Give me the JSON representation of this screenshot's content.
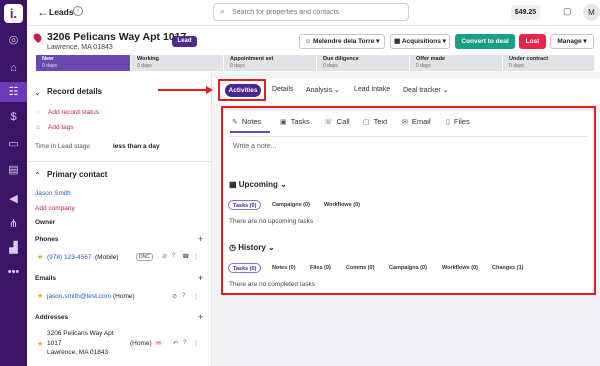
{
  "app": {
    "logo": "i."
  },
  "rail": [
    {
      "icon": "globe-icon",
      "glyph": "◎"
    },
    {
      "icon": "home-icon",
      "glyph": "⌂"
    },
    {
      "icon": "people-icon",
      "glyph": "☷"
    },
    {
      "icon": "dollar-icon",
      "glyph": "$"
    },
    {
      "icon": "inbox-icon",
      "glyph": "▭"
    },
    {
      "icon": "document-icon",
      "glyph": "▤"
    },
    {
      "icon": "megaphone-icon",
      "glyph": "◀"
    },
    {
      "icon": "tree-icon",
      "glyph": "⋔"
    },
    {
      "icon": "chart-icon",
      "glyph": "▟"
    },
    {
      "icon": "more-icon",
      "glyph": "•••"
    }
  ],
  "topbar": {
    "back_glyph": "←",
    "breadcrumb": "Leads",
    "info_glyph": "i",
    "search_placeholder": "Search for properties and contacts",
    "search_glyph": "⌕",
    "credit": "$49.25",
    "chat_glyph": "▢",
    "avatar": "M"
  },
  "header": {
    "address_line1": "3206 Pelicans Way Apt 1017",
    "address_line2": "Lawrence, MA 01843",
    "status_badge": "Lead",
    "assignee": "Melendre dela Torre",
    "acquisitions": "Acquisitions",
    "convert": "Convert to deal",
    "lost": "Lost",
    "manage": "Manage"
  },
  "stages": [
    {
      "name": "New",
      "days": "0 days",
      "active": true
    },
    {
      "name": "Working",
      "days": "0 days",
      "active": false
    },
    {
      "name": "Appointment set",
      "days": "0 days",
      "active": false
    },
    {
      "name": "Due diligence",
      "days": "0 days",
      "active": false
    },
    {
      "name": "Offer made",
      "days": "0 days",
      "active": false
    },
    {
      "name": "Under contract",
      "days": "0 days",
      "active": false
    }
  ],
  "record": {
    "title": "Record details",
    "add_status": "Add record status",
    "add_tags": "Add tags",
    "time_label": "Time in Lead stage",
    "time_value": "less than a day"
  },
  "contact": {
    "title": "Primary contact",
    "name": "Jason Smith",
    "add_company": "Add company",
    "owner_label": "Owner",
    "phones_label": "Phones",
    "phone": "(978) 123-4567",
    "phone_type": "(Mobile)",
    "dnc": "DNC",
    "emails_label": "Emails",
    "email": "jason.smith@test.com",
    "email_type": "(Home)",
    "addresses_label": "Addresses",
    "addr_line1": "3206 Pelicans Way Apt",
    "addr_line2": "1017",
    "addr_line3": "Lawrence, MA 01843",
    "addr_type": "(Home)"
  },
  "tabs": {
    "activities": "Activities",
    "details": "Details",
    "analysis": "Analysis",
    "lead_intake": "Lead intake",
    "deal_tracker": "Deal tracker"
  },
  "activity": {
    "tabs": [
      "Notes",
      "Tasks",
      "Call",
      "Text",
      "Email",
      "Files"
    ],
    "note_placeholder": "Write a note...",
    "upcoming_title": "Upcoming",
    "upcoming_filters": [
      "Tasks (0)",
      "Campaigns (0)",
      "Workflows (0)"
    ],
    "upcoming_empty": "There are no upcoming tasks",
    "history_title": "History",
    "history_filters": [
      "Tasks (0)",
      "Notes (0)",
      "Files (0)",
      "Comms (0)",
      "Campaigns (0)",
      "Workflows (0)",
      "Changes (1)"
    ],
    "history_empty": "There are no completed tasks"
  },
  "colors": {
    "brand": "#3a1466",
    "accent": "#6b48b0",
    "highlight": "#e02020",
    "convert": "#16a085",
    "lost": "#e8234c"
  }
}
